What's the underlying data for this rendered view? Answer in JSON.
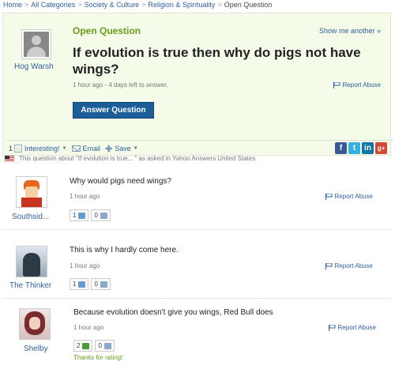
{
  "breadcrumb": {
    "items": [
      "Home",
      "All Categories",
      "Society & Culture",
      "Religion & Spirituality"
    ],
    "current": "Open Question"
  },
  "question": {
    "status": "Open Question",
    "show_another": "Show me another »",
    "asker": "Hog Warsh",
    "title": "If evolution is true then why do pigs not have wings?",
    "meta": "1 hour ago - 4 days left to answer.",
    "report": "Report Abuse",
    "answer_button": "Answer Question"
  },
  "actions": {
    "interesting_count": "1",
    "interesting_label": "Interesting!",
    "email_label": "Email",
    "save_label": "Save",
    "social": [
      "f",
      "t",
      "in",
      "g+"
    ]
  },
  "locale_note": "This question about \"If evolution is true... \" as asked in Yahoo Answers United States",
  "answers": [
    {
      "name": "Southsid...",
      "text": "Why would pigs need wings?",
      "time": "1 hour ago",
      "up": "1",
      "down": "0",
      "report": "Report Abuse"
    },
    {
      "name": "The Thinker",
      "text": "This is why I hardly come here.",
      "time": "1 hour ago",
      "up": "1",
      "down": "0",
      "report": "Report Abuse"
    },
    {
      "name": "Shelby",
      "text": "Because evolution doesn't give you wings, Red Bull does",
      "time": "1 hour ago",
      "up": "2",
      "down": "0",
      "report": "Report Abuse",
      "thanks": "Thanks for rating!"
    }
  ],
  "colors": {
    "link": "#2f5f9e",
    "open_question": "#6a9b1a",
    "answer_button": "#1b5e9a",
    "question_bg": "#f4fbe9"
  }
}
